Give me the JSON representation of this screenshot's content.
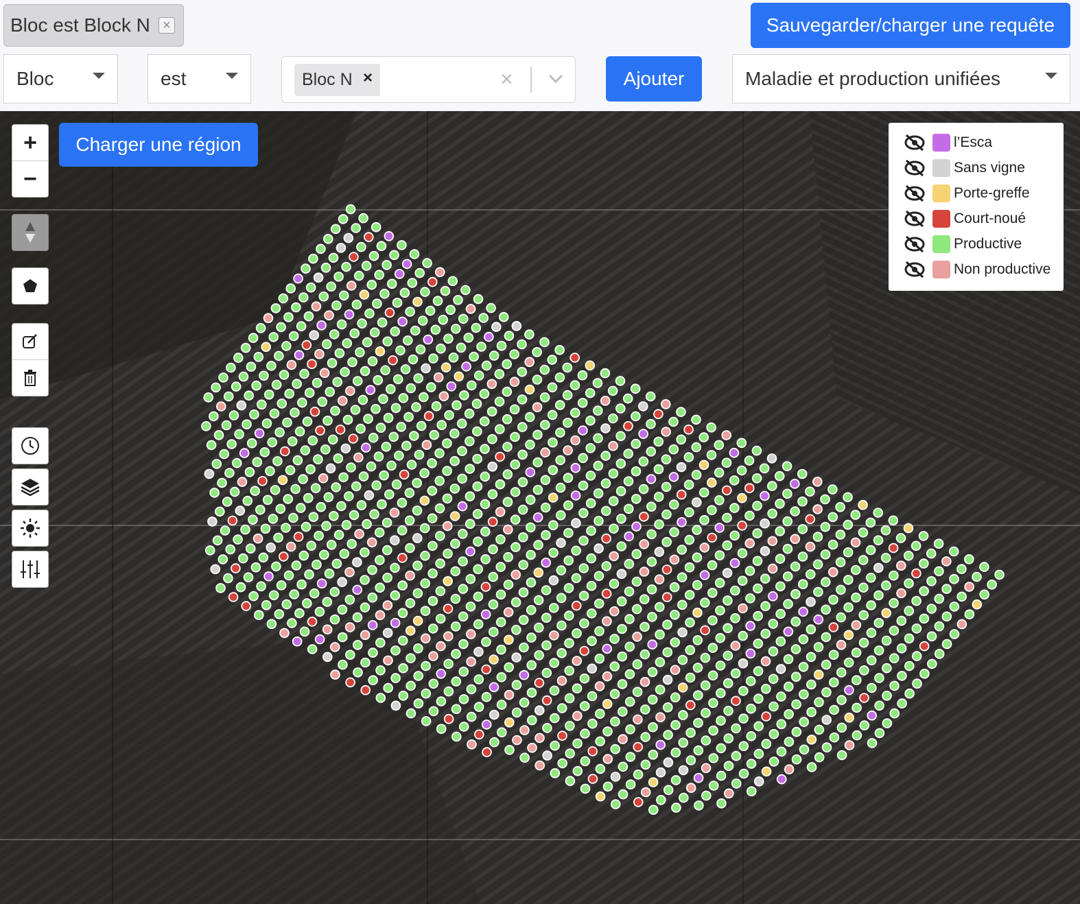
{
  "filter_chip": {
    "label": "Bloc est Block N",
    "close_symbol": "×"
  },
  "save_button": "Sauvegarder/charger une requête",
  "query": {
    "field": "Bloc",
    "operator": "est",
    "value_tag": "Bloc N",
    "value_tag_remove": "×",
    "clear_symbol": "×",
    "add_button": "Ajouter",
    "layer_select": "Maladie et production unifiées"
  },
  "map": {
    "zoom_in": "+",
    "zoom_out": "−",
    "load_region_button": "Charger une région",
    "tools": [
      "compass-icon",
      "polygon-icon",
      "edit-icon",
      "trash-icon",
      "clock-icon",
      "layers-icon",
      "brightness-icon",
      "sliders-icon"
    ]
  },
  "legend": [
    {
      "label": "l’Esca",
      "color": "#c36ce6"
    },
    {
      "label": "Sans vigne",
      "color": "#d3d3d3"
    },
    {
      "label": "Porte-greffe",
      "color": "#f5d272"
    },
    {
      "label": "Court-noué",
      "color": "#d6443c"
    },
    {
      "label": "Productive",
      "color": "#8ee87e"
    },
    {
      "label": "Non productive",
      "color": "#eaa09c"
    }
  ]
}
